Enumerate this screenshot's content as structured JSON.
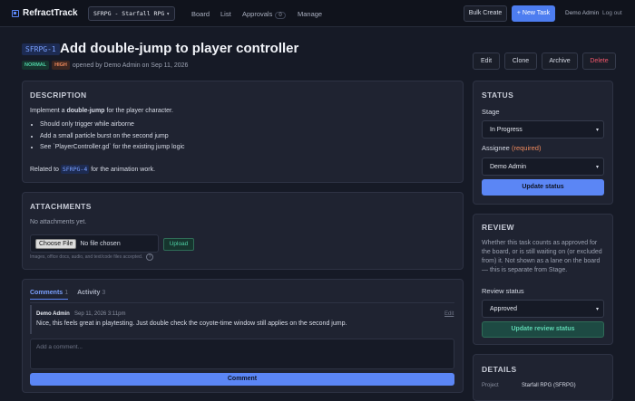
{
  "nav": {
    "app_name": "RefractTrack",
    "project_select": "SFRPG - Starfall RPG",
    "links": [
      "Board",
      "List",
      "Approvals",
      "Manage"
    ],
    "approvals_count": "0",
    "bulk_create": "Bulk Create",
    "new_task": "+ New Task",
    "user": "Demo Admin",
    "logout": "Log out"
  },
  "task": {
    "key": "SFRPG-1",
    "title": "Add double-jump to player controller",
    "tags": [
      "NORMAL",
      "HIGH"
    ],
    "opened_by": "opened by Demo Admin on Sep 11, 2026",
    "actions": [
      "Edit",
      "Clone",
      "Archive",
      "Delete"
    ]
  },
  "description": {
    "heading": "DESCRIPTION",
    "intro_pre": "Implement a ",
    "intro_bold": "double-jump",
    "intro_post": " for the player character.",
    "bullets": [
      "Should only trigger while airborne",
      "Add a small particle burst on the second jump",
      "See `PlayerController.gd` for the existing jump logic"
    ],
    "related_pre": "Related to ",
    "related_key": "SFRPG-4",
    "related_post": " for the animation work."
  },
  "attachments": {
    "heading": "ATTACHMENTS",
    "empty": "No attachments yet.",
    "choose_file": "Choose File",
    "no_file": "No file chosen",
    "upload": "Upload",
    "help": "Images, office docs, audio, and text/code files accepted.",
    "help_icon": "?"
  },
  "comments": {
    "tab_comments": "Comments",
    "comments_count": "1",
    "tab_activity": "Activity",
    "activity_count": "3",
    "items": [
      {
        "author": "Demo Admin",
        "time": "Sep 11, 2026 3:11pm",
        "edit": "Edit",
        "body": "Nice, this feels great in playtesting. Just double check the coyote-time window still applies on the second jump."
      }
    ],
    "placeholder": "Add a comment...",
    "submit": "Comment"
  },
  "status": {
    "heading": "STATUS",
    "stage_label": "Stage",
    "stage_value": "In Progress",
    "assignee_label": "Assignee",
    "assignee_req": "(required)",
    "assignee_value": "Demo Admin",
    "update": "Update status"
  },
  "review": {
    "heading": "REVIEW",
    "description": "Whether this task counts as approved for the board, or is still waiting on (or excluded from) it. Not shown as a lane on the board — this is separate from Stage.",
    "status_label": "Review status",
    "status_value": "Approved",
    "update": "Update review status"
  },
  "details": {
    "heading": "DETAILS",
    "project_label": "Project",
    "project_value": "Starfall RPG (SFRPG)"
  },
  "colors": {
    "background": "#161a26",
    "card": "#1f2331",
    "accent": "#5b86f5",
    "danger": "#f0566a",
    "success": "#4fd1a5"
  }
}
